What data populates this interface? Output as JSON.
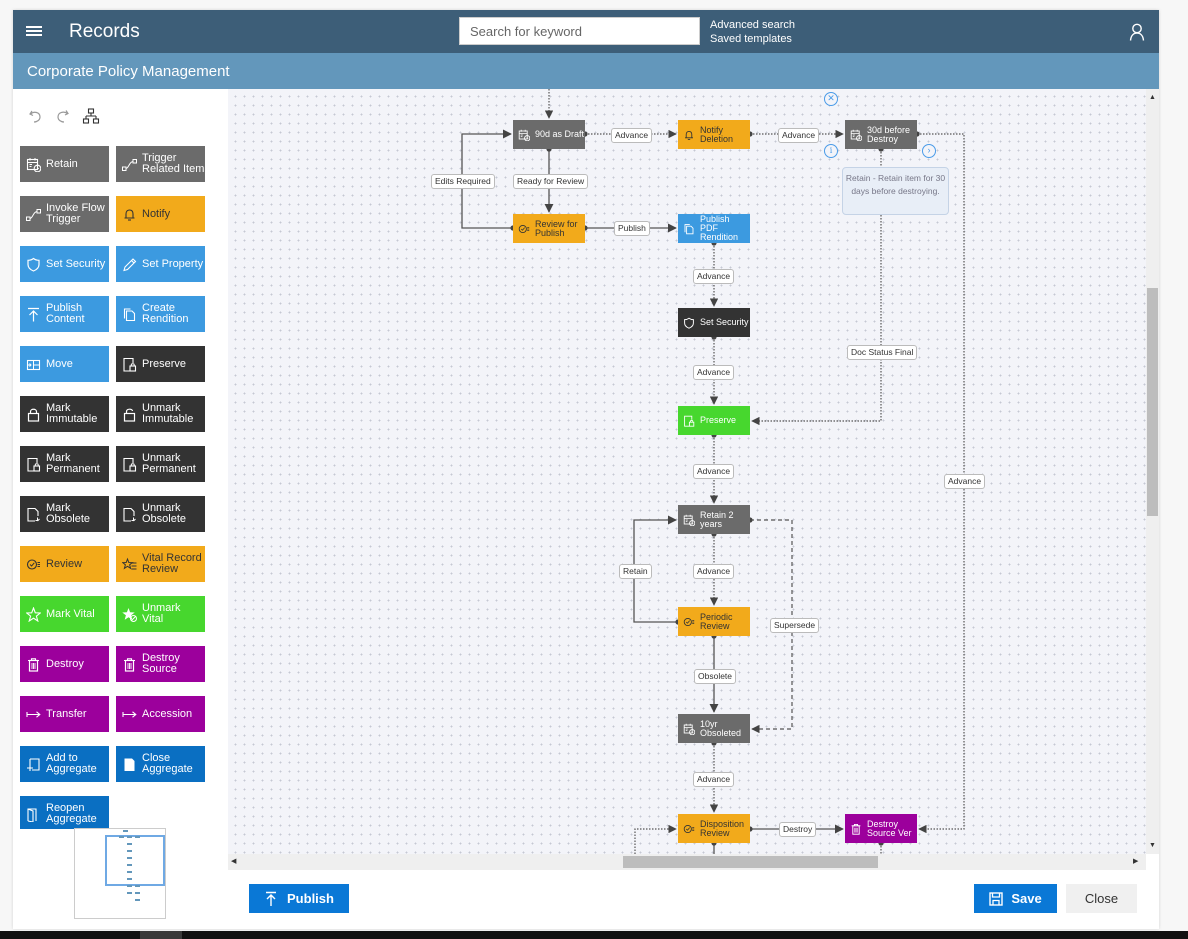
{
  "header": {
    "app_title": "Records",
    "search_placeholder": "Search for keyword",
    "links": [
      "Advanced search",
      "Saved templates"
    ]
  },
  "subheader": {
    "title": "Corporate Policy Management"
  },
  "toolbar": {
    "tools": [
      "undo-icon",
      "redo-icon",
      "auto-layout-icon"
    ]
  },
  "palette": {
    "colors": {
      "gray": "#6b6b6b",
      "orange": "#f2aa1b",
      "blue": "#3c9ae0",
      "dark": "#333333",
      "green": "#47d72e",
      "purple": "#9c009c",
      "navy": "#0a6fc2"
    },
    "items": [
      {
        "label": "Retain",
        "icon": "calendar-clock-icon",
        "color": "gray"
      },
      {
        "label": "Trigger\nRelated Item",
        "icon": "flow-link-icon",
        "color": "gray"
      },
      {
        "label": "Invoke Flow\nTrigger",
        "icon": "flow-link-icon",
        "color": "gray"
      },
      {
        "label": "Notify",
        "icon": "bell-icon",
        "color": "orange"
      },
      {
        "label": "Set Security",
        "icon": "shield-icon",
        "color": "blue"
      },
      {
        "label": "Set Property",
        "icon": "pencil-icon",
        "color": "blue"
      },
      {
        "label": "Publish\nContent",
        "icon": "upload-arrow-icon",
        "color": "blue"
      },
      {
        "label": "Create\nRendition",
        "icon": "copy-icon",
        "color": "blue"
      },
      {
        "label": "Move",
        "icon": "move-folder-icon",
        "color": "blue"
      },
      {
        "label": "Preserve",
        "icon": "document-lock-icon",
        "color": "dark"
      },
      {
        "label": "Mark\nImmutable",
        "icon": "lock-icon",
        "color": "dark"
      },
      {
        "label": "Unmark\nImmutable",
        "icon": "unlock-icon",
        "color": "dark"
      },
      {
        "label": "Mark\nPermanent",
        "icon": "document-lock-icon",
        "color": "dark"
      },
      {
        "label": "Unmark\nPermanent",
        "icon": "document-lock-icon",
        "color": "dark"
      },
      {
        "label": "Mark\nObsolete",
        "icon": "document-expire-icon",
        "color": "dark"
      },
      {
        "label": "Unmark\nObsolete",
        "icon": "document-expire-icon",
        "color": "dark"
      },
      {
        "label": "Review",
        "icon": "review-check-icon",
        "color": "orange"
      },
      {
        "label": "Vital Record\nReview",
        "icon": "star-list-icon",
        "color": "orange"
      },
      {
        "label": "Mark Vital",
        "icon": "star-icon",
        "color": "green"
      },
      {
        "label": "Unmark\nVital",
        "icon": "star-cancel-icon",
        "color": "green"
      },
      {
        "label": "Destroy",
        "icon": "trash-icon",
        "color": "purple"
      },
      {
        "label": "Destroy\nSource",
        "icon": "trash-icon",
        "color": "purple"
      },
      {
        "label": "Transfer",
        "icon": "maps-to-arrow-icon",
        "color": "purple"
      },
      {
        "label": "Accession",
        "icon": "maps-to-arrow-icon",
        "color": "purple"
      },
      {
        "label": "Add to\nAggregate",
        "icon": "add-aggregate-icon",
        "color": "navy"
      },
      {
        "label": "Close\nAggregate",
        "icon": "document-filled-icon",
        "color": "navy"
      },
      {
        "label": "Reopen\nAggregate",
        "icon": "door-open-icon",
        "color": "navy"
      }
    ]
  },
  "diagram": {
    "nodes": [
      {
        "id": "draft",
        "label": "90d as Draft",
        "icon": "calendar-clock-icon",
        "color": "gray"
      },
      {
        "id": "notify",
        "label": "Notify\nDeletion",
        "icon": "bell-icon",
        "color": "orange"
      },
      {
        "id": "before_destroy",
        "label": "30d before\nDestroy",
        "icon": "calendar-clock-icon",
        "color": "gray"
      },
      {
        "id": "review_publish",
        "label": "Review for\nPublish",
        "icon": "review-check-icon",
        "color": "orange"
      },
      {
        "id": "publish_pdf",
        "label": "Publish PDF\nRendition",
        "icon": "copy-icon",
        "color": "blue"
      },
      {
        "id": "set_security",
        "label": "Set Security",
        "icon": "shield-icon",
        "color": "dark"
      },
      {
        "id": "preserve",
        "label": "Preserve",
        "icon": "document-lock-icon",
        "color": "green"
      },
      {
        "id": "retain2",
        "label": "Retain 2\nyears",
        "icon": "calendar-clock-icon",
        "color": "gray"
      },
      {
        "id": "periodic",
        "label": "Periodic\nReview",
        "icon": "review-check-icon",
        "color": "orange"
      },
      {
        "id": "obsoleted",
        "label": "10yr\nObsoleted",
        "icon": "calendar-clock-icon",
        "color": "gray"
      },
      {
        "id": "disposition",
        "label": "Disposition\nReview",
        "icon": "review-check-icon",
        "color": "orange"
      },
      {
        "id": "destroy_src",
        "label": "Destroy\nSource Ver",
        "icon": "trash-icon",
        "color": "purple"
      }
    ],
    "edge_labels": {
      "draft_notify": "Advance",
      "notify_destroy": "Advance",
      "edits_required": "Edits Required",
      "ready_review": "Ready for Review",
      "publish": "Publish",
      "pdf_security": "Advance",
      "security_preserve": "Advance",
      "doc_status_final": "Doc Status Final",
      "preserve_retain": "Advance",
      "right_advance": "Advance",
      "retain_loop": "Retain",
      "retain_periodic": "Advance",
      "supersede": "Supersede",
      "obsolete": "Obsolete",
      "obsoleted_disposition": "Advance",
      "destroy": "Destroy"
    },
    "tooltip": "Retain - Retain item for 30 days before destroying."
  },
  "footer": {
    "publish_label": "Publish",
    "save_label": "Save",
    "close_label": "Close"
  }
}
